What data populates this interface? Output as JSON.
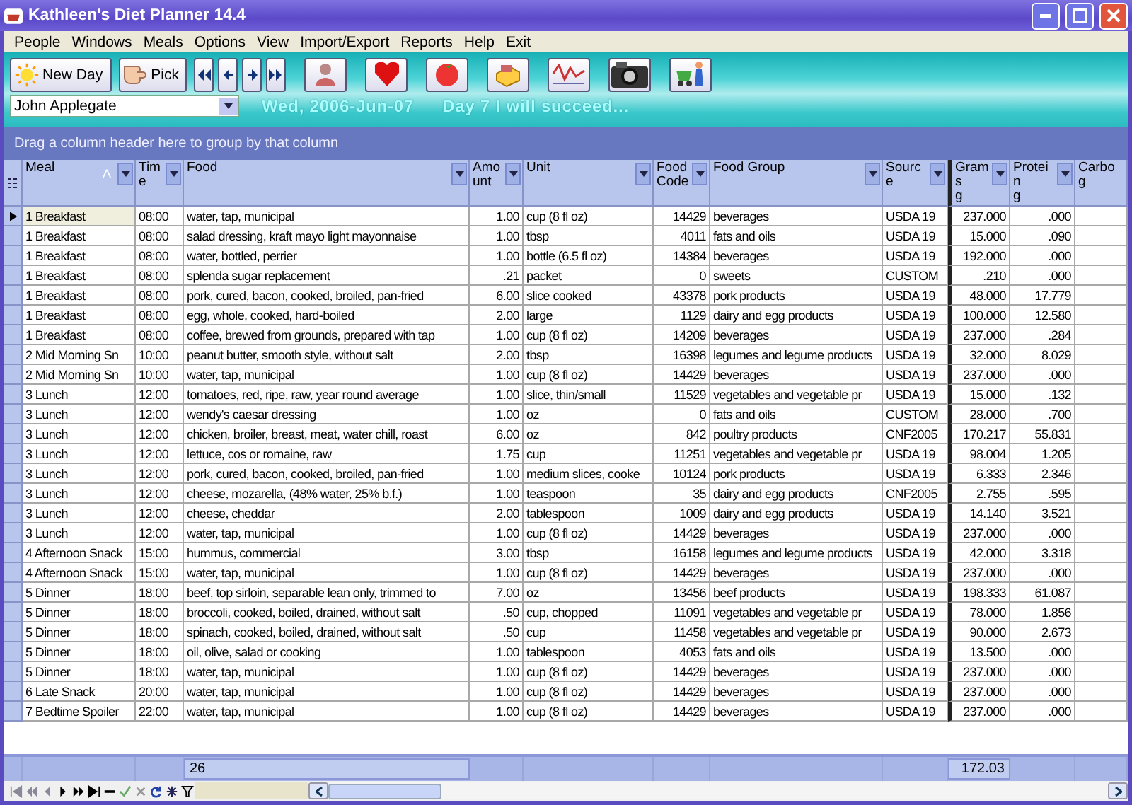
{
  "window": {
    "title": "Kathleen's Diet Planner 14.4"
  },
  "menu": [
    "People",
    "Windows",
    "Meals",
    "Options",
    "View",
    "Import/Export",
    "Reports",
    "Help",
    "Exit"
  ],
  "toolbar": {
    "buttons": [
      {
        "kind": "sun",
        "label": "New Day"
      },
      {
        "kind": "hand",
        "label": "Pick"
      }
    ]
  },
  "person_selector": {
    "value": "John Applegate"
  },
  "date": "Wed, 2006-Jun-07",
  "motto": "Day 7 I will succeed...",
  "group_panel": {
    "hint": "Drag a column header here to group by that column"
  },
  "table": {
    "columns": [
      {
        "label": "Meal",
        "kind": "text",
        "sorted": true
      },
      {
        "label": "Time",
        "kind": "text",
        "sorted": false
      },
      {
        "label": "Food",
        "kind": "text",
        "sorted": false
      },
      {
        "label": "Amount",
        "kind": "number",
        "sorted": false
      },
      {
        "label": "Unit",
        "kind": "text",
        "sorted": false
      },
      {
        "label": "Food Code",
        "kind": "number",
        "sorted": false
      },
      {
        "label": "Food Group",
        "kind": "text",
        "sorted": false
      },
      {
        "label": "Source",
        "kind": "text",
        "sorted": false
      },
      {
        "label": "Grams",
        "unit": "g",
        "kind": "number",
        "sorted": false
      },
      {
        "label": "Protein",
        "unit": "g",
        "kind": "number",
        "sorted": false
      },
      {
        "label": "Carbo",
        "unit": "g",
        "kind": "number",
        "sorted": false
      }
    ],
    "rows": [
      {
        "selected": true,
        "cells": [
          "1 Breakfast",
          "08:00",
          "water, tap, municipal",
          "1.00",
          "cup (8 fl oz)",
          "14429",
          "beverages",
          "USDA 19",
          "237.000",
          ".000"
        ]
      },
      {
        "selected": false,
        "cells": [
          "1 Breakfast",
          "08:00",
          "salad dressing, kraft mayo light mayonnaise",
          "1.00",
          "tbsp",
          "4011",
          "fats and oils",
          "USDA 19",
          "15.000",
          ".090"
        ]
      },
      {
        "selected": false,
        "cells": [
          "1 Breakfast",
          "08:00",
          "water, bottled, perrier",
          "1.00",
          "bottle (6.5 fl oz)",
          "14384",
          "beverages",
          "USDA 19",
          "192.000",
          ".000"
        ]
      },
      {
        "selected": false,
        "cells": [
          "1 Breakfast",
          "08:00",
          "splenda sugar replacement",
          ".21",
          "packet",
          "0",
          "sweets",
          "CUSTOM",
          ".210",
          ".000"
        ]
      },
      {
        "selected": false,
        "cells": [
          "1 Breakfast",
          "08:00",
          "pork, cured, bacon, cooked, broiled, pan-fried",
          "6.00",
          "slice cooked",
          "43378",
          "pork products",
          "USDA 19",
          "48.000",
          "17.779"
        ]
      },
      {
        "selected": false,
        "cells": [
          "1 Breakfast",
          "08:00",
          "egg, whole, cooked, hard-boiled",
          "2.00",
          "large",
          "1129",
          "dairy and egg products",
          "USDA 19",
          "100.000",
          "12.580"
        ]
      },
      {
        "selected": false,
        "cells": [
          "1 Breakfast",
          "08:00",
          "coffee, brewed from grounds, prepared with tap",
          "1.00",
          "cup (8 fl oz)",
          "14209",
          "beverages",
          "USDA 19",
          "237.000",
          ".284"
        ]
      },
      {
        "selected": false,
        "cells": [
          "2 Mid Morning Sn",
          "10:00",
          "peanut butter, smooth style, without salt",
          "2.00",
          "tbsp",
          "16398",
          "legumes and legume products",
          "USDA 19",
          "32.000",
          "8.029"
        ]
      },
      {
        "selected": false,
        "cells": [
          "2 Mid Morning Sn",
          "10:00",
          "water, tap, municipal",
          "1.00",
          "cup (8 fl oz)",
          "14429",
          "beverages",
          "USDA 19",
          "237.000",
          ".000"
        ]
      },
      {
        "selected": false,
        "cells": [
          "3 Lunch",
          "12:00",
          "tomatoes, red, ripe, raw, year round average",
          "1.00",
          "slice, thin/small",
          "11529",
          "vegetables and vegetable pr",
          "USDA 19",
          "15.000",
          ".132"
        ]
      },
      {
        "selected": false,
        "cells": [
          "3 Lunch",
          "12:00",
          "wendy's caesar dressing",
          "1.00",
          "oz",
          "0",
          "fats and oils",
          "CUSTOM",
          "28.000",
          ".700"
        ]
      },
      {
        "selected": false,
        "cells": [
          "3 Lunch",
          "12:00",
          "chicken, broiler, breast, meat, water chill, roast",
          "6.00",
          "oz",
          "842",
          "poultry products",
          "CNF2005",
          "170.217",
          "55.831"
        ]
      },
      {
        "selected": false,
        "cells": [
          "3 Lunch",
          "12:00",
          "lettuce, cos or romaine, raw",
          "1.75",
          "cup",
          "11251",
          "vegetables and vegetable pr",
          "USDA 19",
          "98.004",
          "1.205"
        ]
      },
      {
        "selected": false,
        "cells": [
          "3 Lunch",
          "12:00",
          "pork, cured, bacon, cooked, broiled, pan-fried",
          "1.00",
          "medium slices, cooke",
          "10124",
          "pork products",
          "USDA 19",
          "6.333",
          "2.346"
        ]
      },
      {
        "selected": false,
        "cells": [
          "3 Lunch",
          "12:00",
          "cheese, mozarella, (48% water, 25% b.f.)",
          "1.00",
          "teaspoon",
          "35",
          "dairy and egg products",
          "CNF2005",
          "2.755",
          ".595"
        ]
      },
      {
        "selected": false,
        "cells": [
          "3 Lunch",
          "12:00",
          "cheese, cheddar",
          "2.00",
          "tablespoon",
          "1009",
          "dairy and egg products",
          "USDA 19",
          "14.140",
          "3.521"
        ]
      },
      {
        "selected": false,
        "cells": [
          "3 Lunch",
          "12:00",
          "water, tap, municipal",
          "1.00",
          "cup (8 fl oz)",
          "14429",
          "beverages",
          "USDA 19",
          "237.000",
          ".000"
        ]
      },
      {
        "selected": false,
        "cells": [
          "4 Afternoon Snack",
          "15:00",
          "hummus, commercial",
          "3.00",
          "tbsp",
          "16158",
          "legumes and legume products",
          "USDA 19",
          "42.000",
          "3.318"
        ]
      },
      {
        "selected": false,
        "cells": [
          "4 Afternoon Snack",
          "15:00",
          "water, tap, municipal",
          "1.00",
          "cup (8 fl oz)",
          "14429",
          "beverages",
          "USDA 19",
          "237.000",
          ".000"
        ]
      },
      {
        "selected": false,
        "cells": [
          "5 Dinner",
          "18:00",
          "beef, top sirloin, separable lean only, trimmed to",
          "7.00",
          "oz",
          "13456",
          "beef products",
          "USDA 19",
          "198.333",
          "61.087"
        ]
      },
      {
        "selected": false,
        "cells": [
          "5 Dinner",
          "18:00",
          "broccoli, cooked, boiled, drained, without salt",
          ".50",
          "cup, chopped",
          "11091",
          "vegetables and vegetable pr",
          "USDA 19",
          "78.000",
          "1.856"
        ]
      },
      {
        "selected": false,
        "cells": [
          "5 Dinner",
          "18:00",
          "spinach, cooked, boiled, drained, without salt",
          ".50",
          "cup",
          "11458",
          "vegetables and vegetable pr",
          "USDA 19",
          "90.000",
          "2.673"
        ]
      },
      {
        "selected": false,
        "cells": [
          "5 Dinner",
          "18:00",
          "oil, olive, salad or cooking",
          "1.00",
          "tablespoon",
          "4053",
          "fats and oils",
          "USDA 19",
          "13.500",
          ".000"
        ]
      },
      {
        "selected": false,
        "cells": [
          "5 Dinner",
          "18:00",
          "water, tap, municipal",
          "1.00",
          "cup (8 fl oz)",
          "14429",
          "beverages",
          "USDA 19",
          "237.000",
          ".000"
        ]
      },
      {
        "selected": false,
        "cells": [
          "6 Late Snack",
          "20:00",
          "water, tap, municipal",
          "1.00",
          "cup (8 fl oz)",
          "14429",
          "beverages",
          "USDA 19",
          "237.000",
          ".000"
        ]
      },
      {
        "selected": false,
        "cells": [
          "7 Bedtime Spoiler",
          "22:00",
          "water, tap, municipal",
          "1.00",
          "cup (8 fl oz)",
          "14429",
          "beverages",
          "USDA 19",
          "237.000",
          ".000"
        ]
      }
    ],
    "footer": {
      "count": "26",
      "grams_total": "172.03"
    }
  }
}
